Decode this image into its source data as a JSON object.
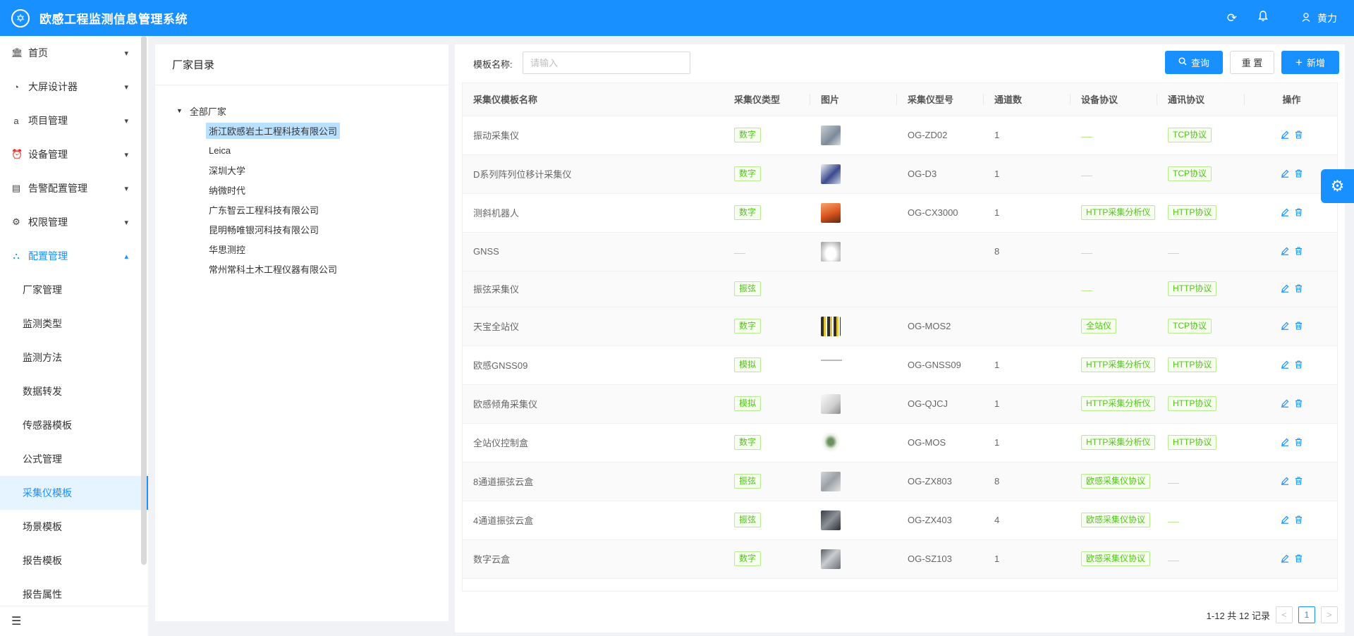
{
  "app": {
    "title": "欧感工程监测信息管理系统",
    "user_name": "黄力"
  },
  "sidebar": {
    "menu": [
      {
        "label": "首页",
        "icon": "bank-icon"
      },
      {
        "label": "大屏设计器",
        "icon": "dashboard-icon"
      },
      {
        "label": "项目管理",
        "icon": "amazon-icon"
      },
      {
        "label": "设备管理",
        "icon": "alarm-icon"
      },
      {
        "label": "告警配置管理",
        "icon": "profile-icon"
      },
      {
        "label": "权限管理",
        "icon": "setting-icon"
      },
      {
        "label": "配置管理",
        "icon": "cluster-icon",
        "open": true
      }
    ],
    "sub_menu": [
      "厂家管理",
      "监测类型",
      "监测方法",
      "数据转发",
      "传感器模板",
      "公式管理",
      "采集仪模板",
      "场景模板",
      "报告模板",
      "报告属性"
    ],
    "active_sub": "采集仪模板"
  },
  "tree_panel": {
    "title": "厂家目录",
    "root": "全部厂家",
    "nodes": [
      "浙江欧感岩土工程科技有限公司",
      "Leica",
      "深圳大学",
      "纳微时代",
      "广东智云工程科技有限公司",
      "昆明畅唯银河科技有限公司",
      "华思测控",
      "常州常科土木工程仪器有限公司"
    ],
    "selected": "浙江欧感岩土工程科技有限公司"
  },
  "search": {
    "label": "模板名称:",
    "placeholder": "请输入",
    "query_label": "查询",
    "reset_label": "重 置",
    "add_label": "新增"
  },
  "table": {
    "columns": [
      "采集仪模板名称",
      "采集仪类型",
      "图片",
      "采集仪型号",
      "通道数",
      "设备协议",
      "通讯协议",
      "操作"
    ],
    "rows": [
      {
        "name": "振动采集仪",
        "type": "数字",
        "image": "gray-device",
        "model": "OG-ZD02",
        "channels": "1",
        "device_protocol": "",
        "comm_protocol": "TCP协议"
      },
      {
        "name": "D系列阵列位移计采集仪",
        "type": "数字",
        "image": "blue-device",
        "model": "OG-D3",
        "channels": "1",
        "device_protocol": "",
        "comm_protocol": "TCP协议"
      },
      {
        "name": "测斜机器人",
        "type": "数字",
        "image": "orange-robot",
        "model": "OG-CX3000",
        "channels": "1",
        "device_protocol": "HTTP采集分析仪",
        "comm_protocol": "HTTP协议"
      },
      {
        "name": "GNSS",
        "type": "",
        "image": "gnss-antenna",
        "model": "",
        "channels": "8",
        "device_protocol": "",
        "comm_protocol": ""
      },
      {
        "name": "振弦采集仪",
        "type": "振弦",
        "image": "",
        "model": "",
        "channels": "",
        "device_protocol": "",
        "comm_protocol": "HTTP协议"
      },
      {
        "name": "天宝全站仪",
        "type": "数字",
        "image": "total-station-set",
        "model": "OG-MOS2",
        "channels": "",
        "device_protocol": "全站仪",
        "comm_protocol": "TCP协议"
      },
      {
        "name": "欧感GNSS09",
        "type": "模拟",
        "image": "thin-line",
        "model": "OG-GNSS09",
        "channels": "1",
        "device_protocol": "HTTP采集分析仪",
        "comm_protocol": "HTTP协议"
      },
      {
        "name": "欧感倾角采集仪",
        "type": "模拟",
        "image": "white-box",
        "model": "OG-QJCJ",
        "channels": "1",
        "device_protocol": "HTTP采集分析仪",
        "comm_protocol": "HTTP协议"
      },
      {
        "name": "全站仪控制盒",
        "type": "数字",
        "image": "total-station",
        "model": "OG-MOS",
        "channels": "1",
        "device_protocol": "HTTP采集分析仪",
        "comm_protocol": "HTTP协议"
      },
      {
        "name": "8通道振弦云盒",
        "type": "振弦",
        "image": "gray-box",
        "model": "OG-ZX803",
        "channels": "8",
        "device_protocol": "欧感采集仪协议",
        "comm_protocol": ""
      },
      {
        "name": "4通道振弦云盒",
        "type": "振弦",
        "image": "dark-box",
        "model": "OG-ZX403",
        "channels": "4",
        "device_protocol": "欧感采集仪协议",
        "comm_protocol": ""
      },
      {
        "name": "数字云盒",
        "type": "数字",
        "image": "silver-box",
        "model": "OG-SZ103",
        "channels": "1",
        "device_protocol": "欧感采集仪协议",
        "comm_protocol": ""
      }
    ]
  },
  "pagination": {
    "summary": "1-12 共 12 记录",
    "current_page": "1"
  },
  "colors": {
    "primary": "#1890ff",
    "tag_green": "#52c41a",
    "tag_border": "#b7eb8f"
  }
}
